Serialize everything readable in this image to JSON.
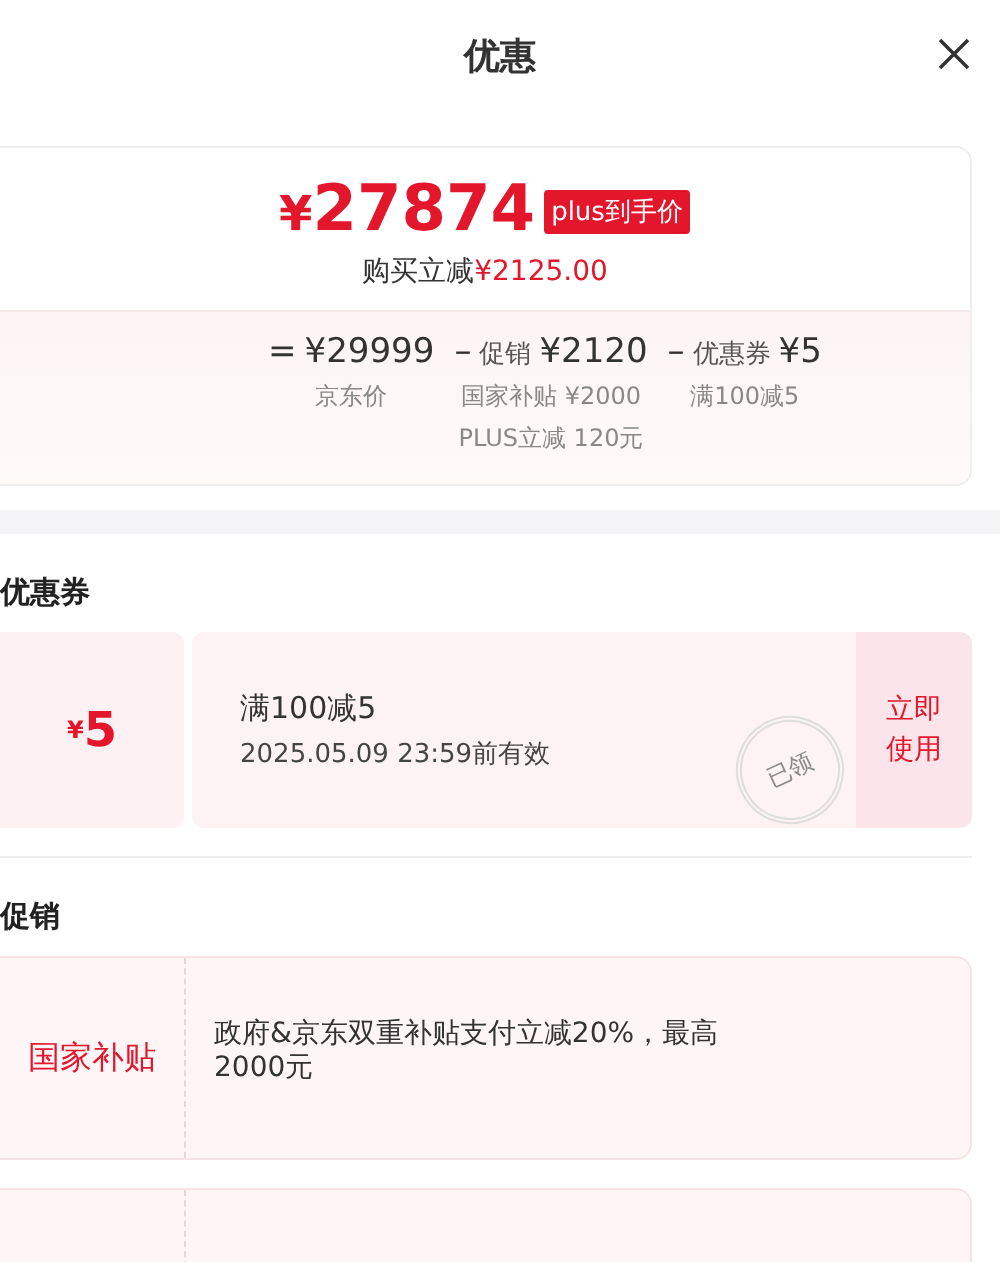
{
  "header": {
    "title": "优惠"
  },
  "summary": {
    "price_symbol": "¥",
    "price": "27874",
    "badge": "plus到手价",
    "saving_label": "购买立减",
    "saving_amount": "¥2125.00",
    "breakdown": [
      {
        "operator": "=",
        "amount": "¥29999",
        "notes": [
          "京东价"
        ]
      },
      {
        "operator": "–",
        "label": "促销",
        "amount": "¥2120",
        "notes": [
          "国家补贴 ¥2000",
          "PLUS立减 120元"
        ]
      },
      {
        "operator": "–",
        "label": "优惠券",
        "amount": "¥5",
        "notes": [
          "满100减5"
        ]
      }
    ]
  },
  "coupons": {
    "title": "优惠券",
    "items": [
      {
        "symbol": "¥",
        "amount": "5",
        "title": "满100减5",
        "validity": "2025.05.09 23:59前有效",
        "action": "立即使用",
        "stamp": "已领"
      }
    ]
  },
  "promotions": {
    "title": "促销",
    "items": [
      {
        "kind": "full",
        "tag": "国家补贴",
        "text": "政府&京东双重补贴支付立减20%，最高2000元"
      },
      {
        "kind": "partial"
      }
    ]
  }
}
